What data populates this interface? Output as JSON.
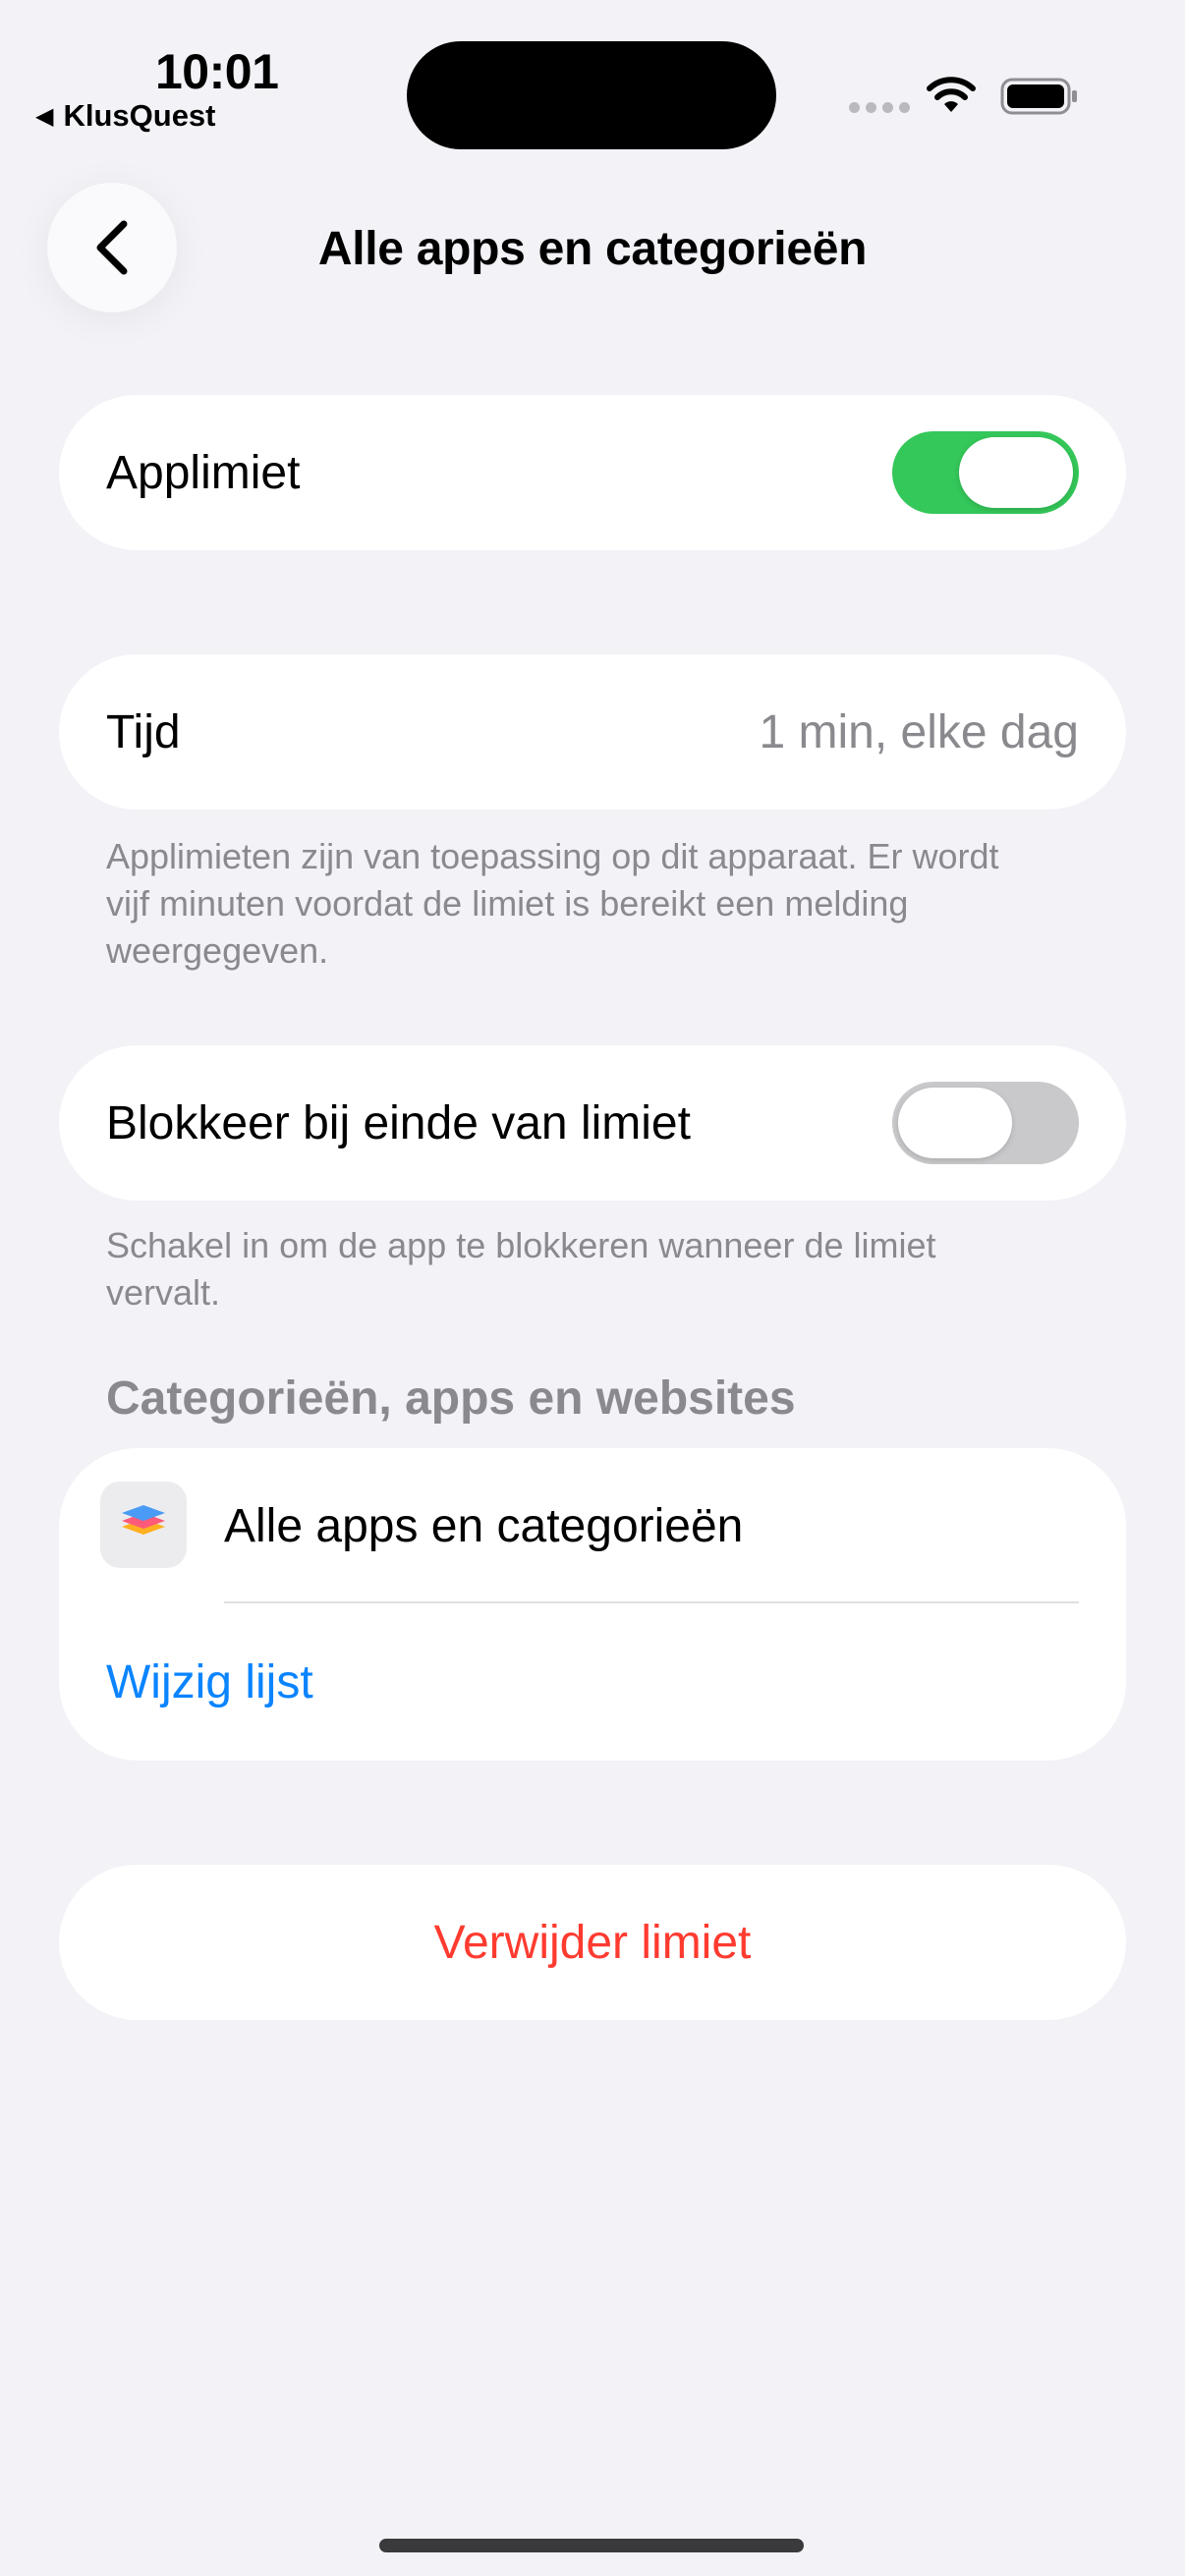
{
  "status_bar": {
    "time": "10:01",
    "back_app": "KlusQuest"
  },
  "nav": {
    "title": "Alle apps en categorieën"
  },
  "app_limit": {
    "label": "Applimiet",
    "enabled": true
  },
  "time_setting": {
    "label": "Tijd",
    "value": "1 min, elke dag",
    "footnote": "Applimieten zijn van toepassing op dit apparaat. Er wordt vijf minuten voordat de limiet is bereikt een melding weergegeven."
  },
  "block_setting": {
    "label": "Blokkeer bij einde van limiet",
    "enabled": false,
    "footnote": "Schakel in om de app te blokkeren wanneer de limiet vervalt."
  },
  "categories_section": {
    "header": "Categorieën, apps en websites",
    "items": [
      {
        "label": "Alle apps en categorieën",
        "icon": "stack-layers-icon"
      }
    ],
    "edit_link": "Wijzig lijst"
  },
  "delete_button": {
    "label": "Verwijder limiet"
  },
  "colors": {
    "background": "#f2f2f7",
    "toggle_on": "#34c759",
    "toggle_off": "#c9c9cc",
    "link": "#0a84ff",
    "destructive": "#ff3b30",
    "secondary_text": "#8a8a8e"
  }
}
